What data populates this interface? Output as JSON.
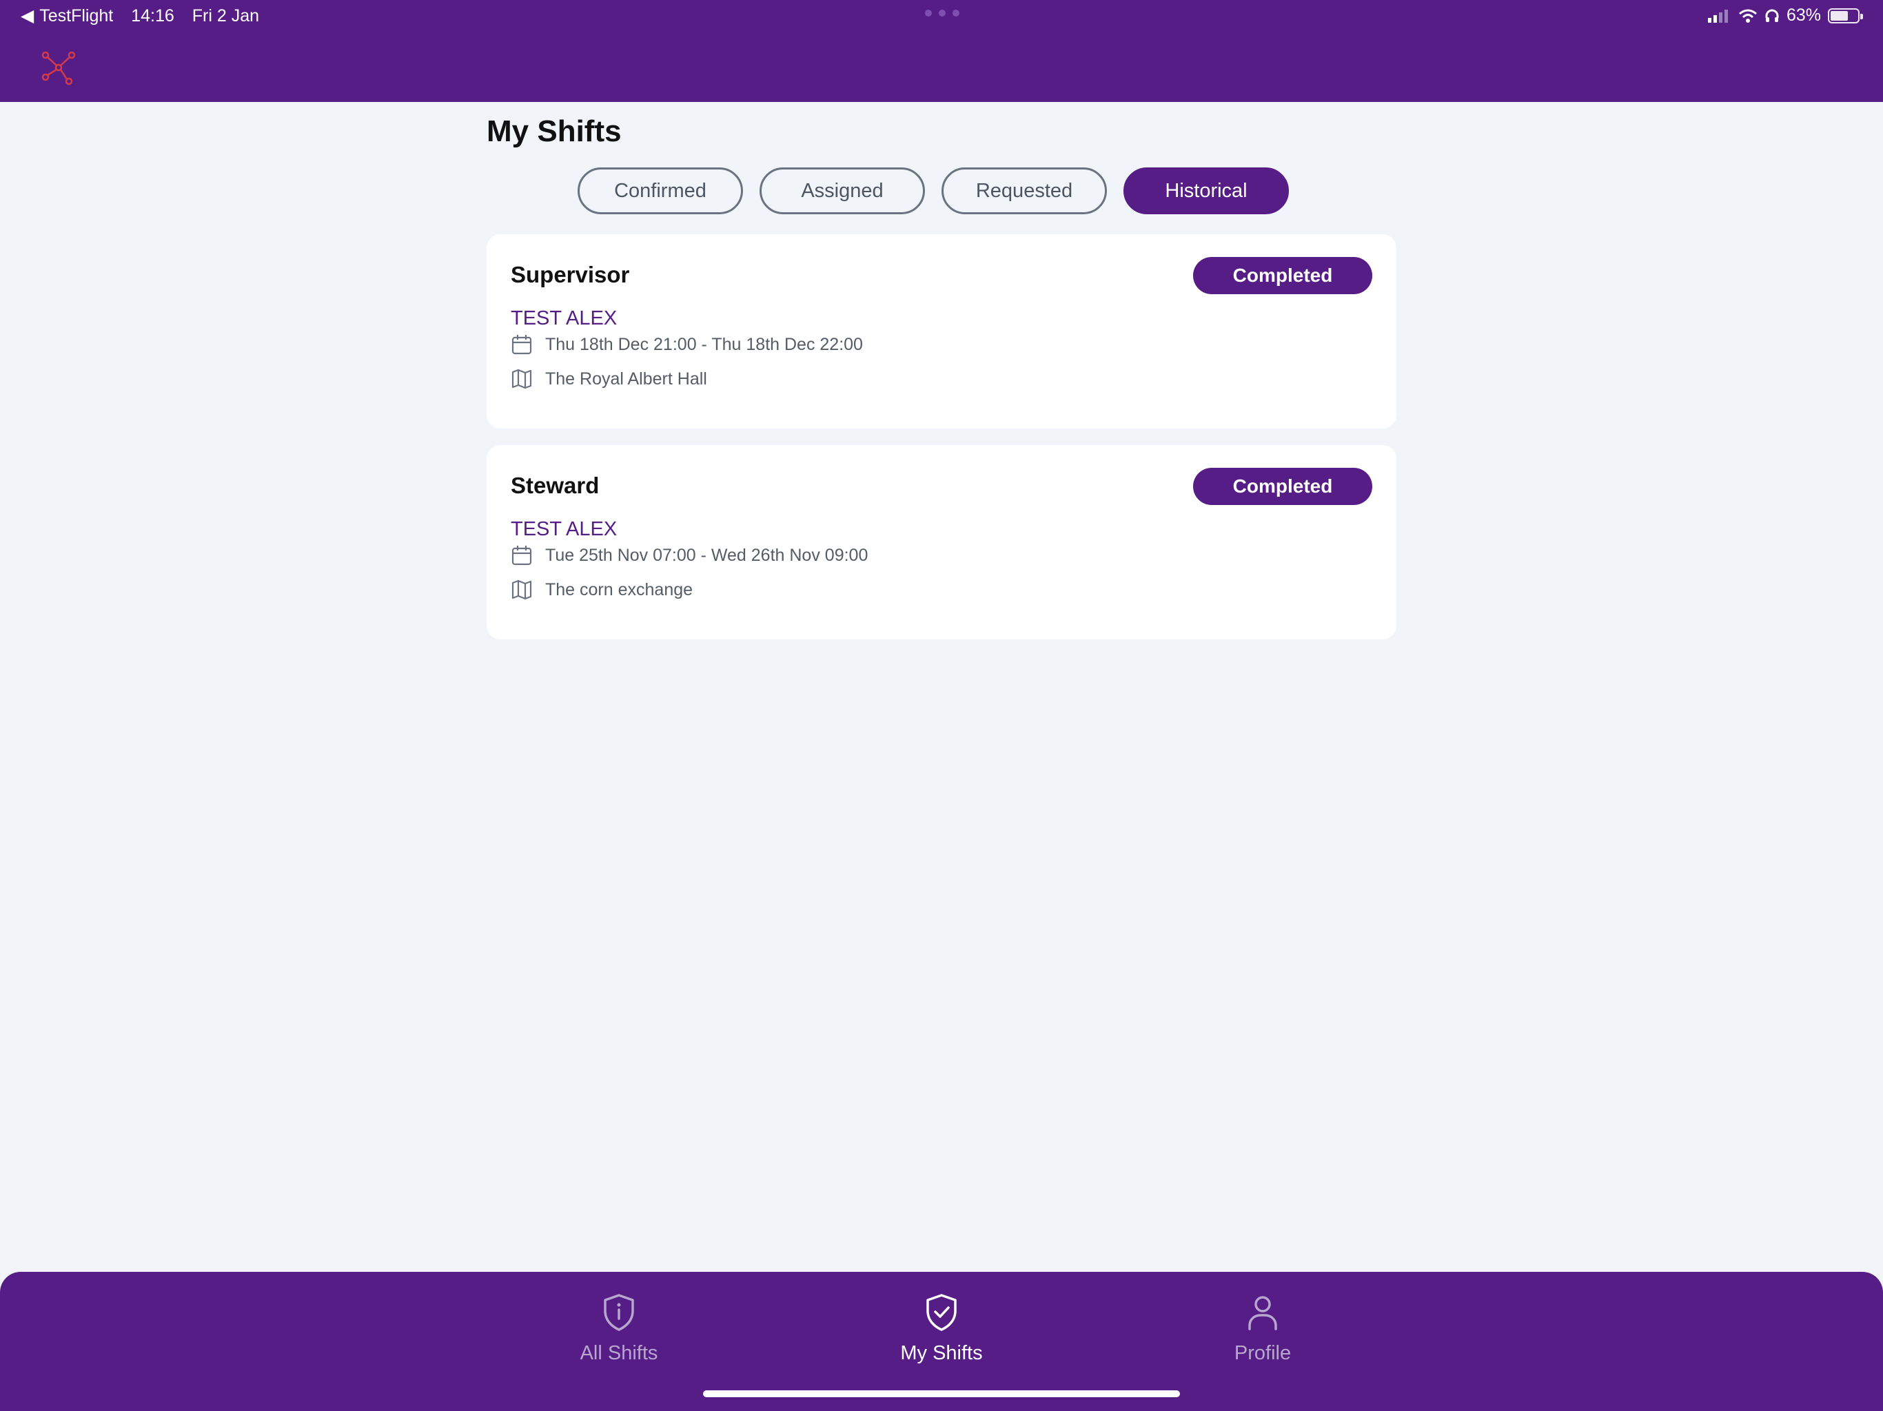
{
  "status_bar": {
    "back_app": "TestFlight",
    "time": "14:16",
    "date": "Fri 2 Jan",
    "battery": "63%"
  },
  "colors": {
    "brand_purple": "#561d86",
    "background": "#f1f4f9",
    "logo_red": "#d33b4b"
  },
  "page": {
    "title": "My Shifts"
  },
  "tabs": [
    {
      "label": "Confirmed",
      "active": false
    },
    {
      "label": "Assigned",
      "active": false
    },
    {
      "label": "Requested",
      "active": false
    },
    {
      "label": "Historical",
      "active": true
    }
  ],
  "shifts": [
    {
      "role": "Supervisor",
      "status": "Completed",
      "person": "TEST ALEX",
      "datetime": "Thu 18th Dec 21:00 - Thu 18th Dec 22:00",
      "location": "The Royal Albert Hall"
    },
    {
      "role": "Steward",
      "status": "Completed",
      "person": "TEST ALEX",
      "datetime": "Tue 25th Nov 07:00 - Wed 26th Nov 09:00",
      "location": "The corn exchange"
    }
  ],
  "bottom_nav": [
    {
      "label": "All Shifts",
      "icon": "shield-info-icon",
      "active": false
    },
    {
      "label": "My Shifts",
      "icon": "shield-check-icon",
      "active": true
    },
    {
      "label": "Profile",
      "icon": "person-icon",
      "active": false
    }
  ]
}
